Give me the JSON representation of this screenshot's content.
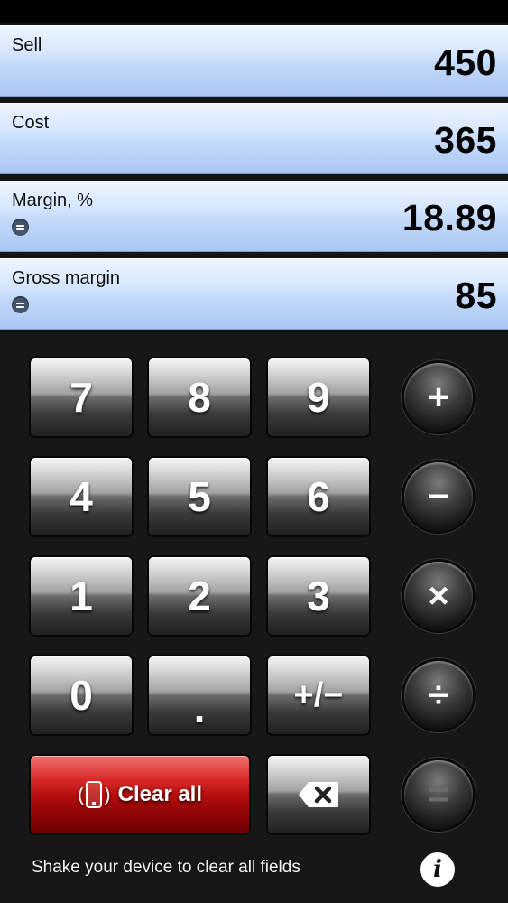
{
  "fields": [
    {
      "label": "Sell",
      "value": "450",
      "has_equals_icon": false
    },
    {
      "label": "Cost",
      "value": "365",
      "has_equals_icon": false
    },
    {
      "label": "Margin, %",
      "value": "18.89",
      "has_equals_icon": true
    },
    {
      "label": "Gross margin",
      "value": "85",
      "has_equals_icon": true
    }
  ],
  "keys": {
    "k7": "7",
    "k8": "8",
    "k9": "9",
    "k4": "4",
    "k5": "5",
    "k6": "6",
    "k1": "1",
    "k2": "2",
    "k3": "3",
    "k0": "0",
    "dot": ".",
    "sign": "+/−"
  },
  "operators": {
    "plus": "+",
    "minus": "−",
    "multiply": "×",
    "divide": "÷",
    "equals": "="
  },
  "clear_all_label": "Clear all",
  "footer": {
    "hint": "Shake your device to clear all fields",
    "info": "i"
  },
  "icons": {
    "clear": "phone-shake-icon",
    "backspace": "backspace-icon",
    "equals_field": "equals-icon",
    "info": "info-icon"
  },
  "colors": {
    "field_blue": "#c3d9f9",
    "clear_red": "#c41414",
    "key_gray": "#8a8a8a"
  }
}
